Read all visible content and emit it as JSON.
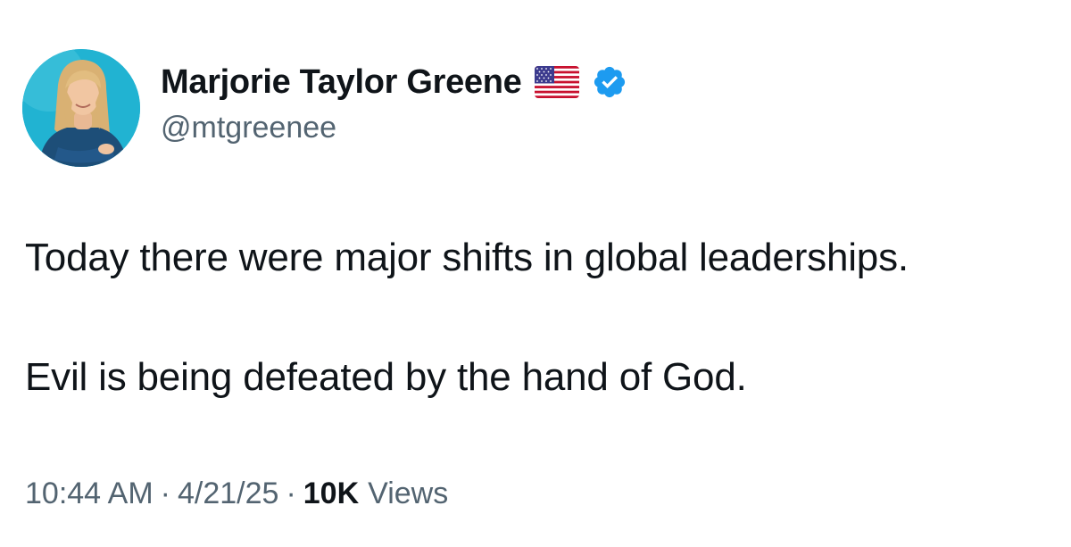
{
  "author": {
    "display_name": "Marjorie Taylor Greene",
    "handle": "@mtgreenee",
    "flag_icon": "us-flag-icon",
    "verified_icon": "verified-badge-icon",
    "verified_color": "#1d9bf0",
    "avatar_background": "#1fb0cf"
  },
  "tweet": {
    "lines": [
      "Today there were major shifts in global leaderships.",
      "Evil is being defeated by the hand of God."
    ]
  },
  "meta": {
    "time": "10:44 AM",
    "separator": "·",
    "date": "4/21/25",
    "views_count": "10K",
    "views_label": "Views"
  },
  "colors": {
    "text_primary": "#0f1419",
    "text_secondary": "#536471"
  }
}
